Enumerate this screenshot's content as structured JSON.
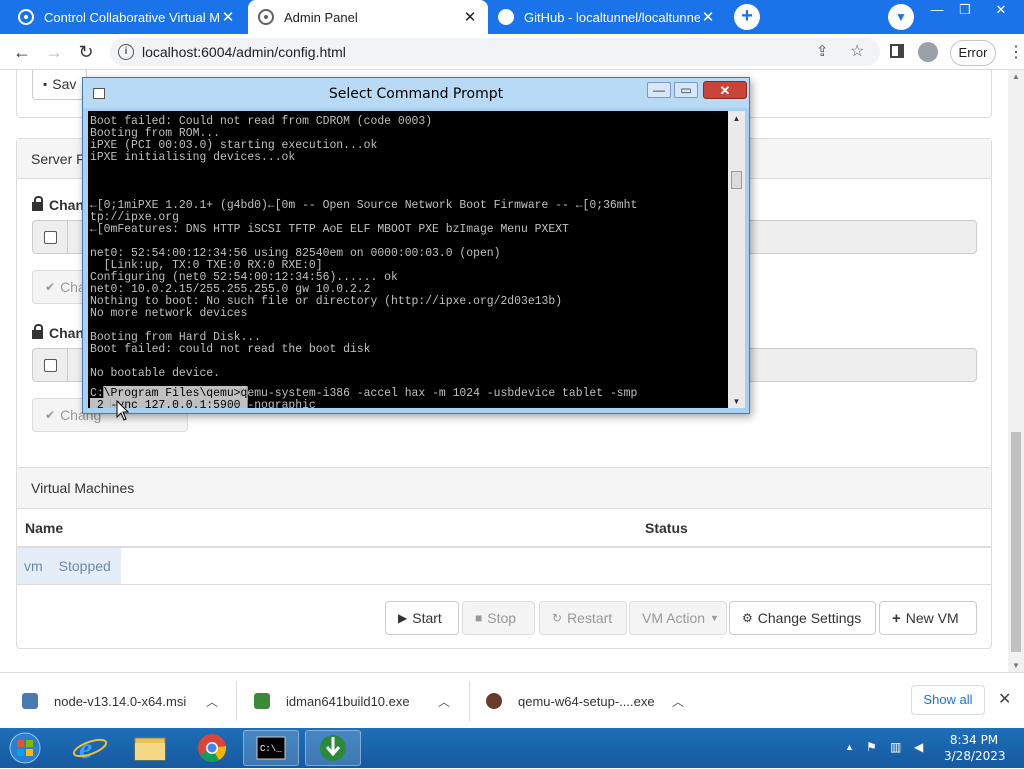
{
  "browser": {
    "tabs": [
      {
        "title": "Control Collaborative Virtual Mac"
      },
      {
        "title": "Admin Panel"
      },
      {
        "title": "GitHub - localtunnel/localtunnel"
      }
    ],
    "address": "localhost:6004/admin/config.html",
    "error_label": "Error"
  },
  "page": {
    "save_partial": "Sav",
    "server_panel_partial": "Server F",
    "section1_label_partial": "Chan",
    "section1_button_partial": "Cha",
    "section2_label_partial": "Chan",
    "section2_button_partial": "Chang",
    "vm_panel": {
      "title": "Virtual Machines",
      "col_name": "Name",
      "col_status": "Status",
      "rows": [
        {
          "name": "vm",
          "status": "Stopped"
        }
      ]
    },
    "actions": {
      "start": "Start",
      "stop": "Stop",
      "restart": "Restart",
      "vm_action": "VM Action",
      "change_settings": "Change Settings",
      "new_vm": "New VM"
    }
  },
  "cmd": {
    "title": "Select Command Prompt",
    "lines": [
      "Boot failed: Could not read from CDROM (code 0003)",
      "Booting from ROM...",
      "iPXE (PCI 00:03.0) starting execution...ok",
      "iPXE initialising devices...ok",
      "",
      "",
      "",
      "←[0;1miPXE 1.20.1+ (g4bd0)←[0m -- Open Source Network Boot Firmware -- ←[0;36mht",
      "tp://ipxe.org",
      "←[0mFeatures: DNS HTTP iSCSI TFTP AoE ELF MBOOT PXE bzImage Menu PXEXT",
      "",
      "net0: 52:54:00:12:34:56 using 82540em on 0000:00:03.0 (open)",
      "  [Link:up, TX:0 TXE:0 RX:0 RXE:0]",
      "Configuring (net0 52:54:00:12:34:56)...... ok",
      "net0: 10.0.2.15/255.255.255.0 gw 10.0.2.2",
      "Nothing to boot: No such file or directory (http://ipxe.org/2d03e13b)",
      "No more network devices",
      "",
      "Booting from Hard Disk...",
      "Boot failed: could not read the boot disk",
      "",
      "No bootable device.",
      ""
    ],
    "prompt_a": "C:",
    "prompt_b": "\\Program Files\\qemu>",
    "prompt_c": "q",
    "prompt_d": "emu-system-i386 -accel hax -m 1024 -usbdevice tablet -smp",
    "wrap_a": " 2 ",
    "wrap_b": "-vnc 127.0.0.1:5900 ",
    "wrap_c": "-nographic"
  },
  "downloads": [
    {
      "name": "node-v13.14.0-x64.msi"
    },
    {
      "name": "idman641build10.exe"
    },
    {
      "name": "qemu-w64-setup-....exe"
    }
  ],
  "show_all": "Show all",
  "clock": {
    "time": "8:34 PM",
    "date": "3/28/2023"
  },
  "colors": {
    "chrome_blue": "#1a73e8",
    "taskbar": "#1e6fb8",
    "close_red": "#c9453a"
  },
  "icons": [
    "github-icon",
    "star-icon",
    "share-icon",
    "lock-icon",
    "play-icon",
    "stop-icon",
    "refresh-icon",
    "gear-icon",
    "plus-icon",
    "windows-start-icon",
    "ie-icon",
    "explorer-icon",
    "chrome-icon",
    "cmd-icon",
    "idm-icon"
  ]
}
